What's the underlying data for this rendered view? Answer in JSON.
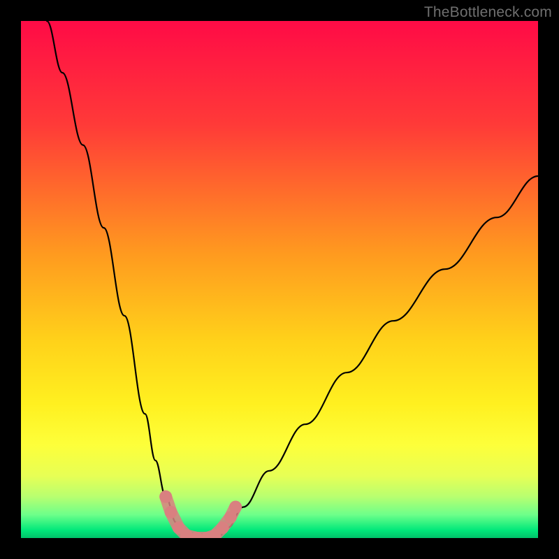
{
  "watermark": "TheBottleneck.com",
  "colors": {
    "frame": "#000000",
    "curve": "#000000",
    "marker": "#d98080",
    "watermark": "#6f6f6f"
  },
  "chart_data": {
    "type": "line",
    "title": "",
    "xlabel": "",
    "ylabel": "",
    "xlim": [
      0,
      100
    ],
    "ylim": [
      0,
      100
    ],
    "grid": false,
    "series": [
      {
        "name": "left-curve",
        "x": [
          5,
          8,
          12,
          16,
          20,
          24,
          26,
          28,
          30,
          31,
          32
        ],
        "values": [
          100,
          90,
          76,
          60,
          43,
          24,
          15,
          8,
          3,
          1,
          0
        ]
      },
      {
        "name": "valley-floor",
        "x": [
          32,
          34,
          36,
          38
        ],
        "values": [
          0,
          0,
          0,
          0
        ]
      },
      {
        "name": "right-curve",
        "x": [
          38,
          40,
          43,
          48,
          55,
          63,
          72,
          82,
          92,
          100
        ],
        "values": [
          0,
          2,
          6,
          13,
          22,
          32,
          42,
          52,
          62,
          70
        ]
      }
    ],
    "markers": {
      "name": "highlighted-points",
      "color": "#d98080",
      "points": [
        {
          "x": 28,
          "y": 8
        },
        {
          "x": 29,
          "y": 5
        },
        {
          "x": 30.5,
          "y": 2
        },
        {
          "x": 32,
          "y": 0.5
        },
        {
          "x": 34,
          "y": 0
        },
        {
          "x": 36,
          "y": 0
        },
        {
          "x": 37.5,
          "y": 0.5
        },
        {
          "x": 39,
          "y": 2
        },
        {
          "x": 40.5,
          "y": 4
        },
        {
          "x": 41.5,
          "y": 6
        }
      ]
    },
    "background_gradient": {
      "stops": [
        {
          "pos": 0.0,
          "color": "#ff0b46"
        },
        {
          "pos": 0.2,
          "color": "#ff3a38"
        },
        {
          "pos": 0.45,
          "color": "#ff9a1f"
        },
        {
          "pos": 0.62,
          "color": "#ffd21a"
        },
        {
          "pos": 0.74,
          "color": "#fff020"
        },
        {
          "pos": 0.82,
          "color": "#fdff3a"
        },
        {
          "pos": 0.88,
          "color": "#e7ff55"
        },
        {
          "pos": 0.92,
          "color": "#b8ff70"
        },
        {
          "pos": 0.955,
          "color": "#6dff8a"
        },
        {
          "pos": 0.985,
          "color": "#00e87a"
        },
        {
          "pos": 1.0,
          "color": "#00c26a"
        }
      ]
    }
  }
}
